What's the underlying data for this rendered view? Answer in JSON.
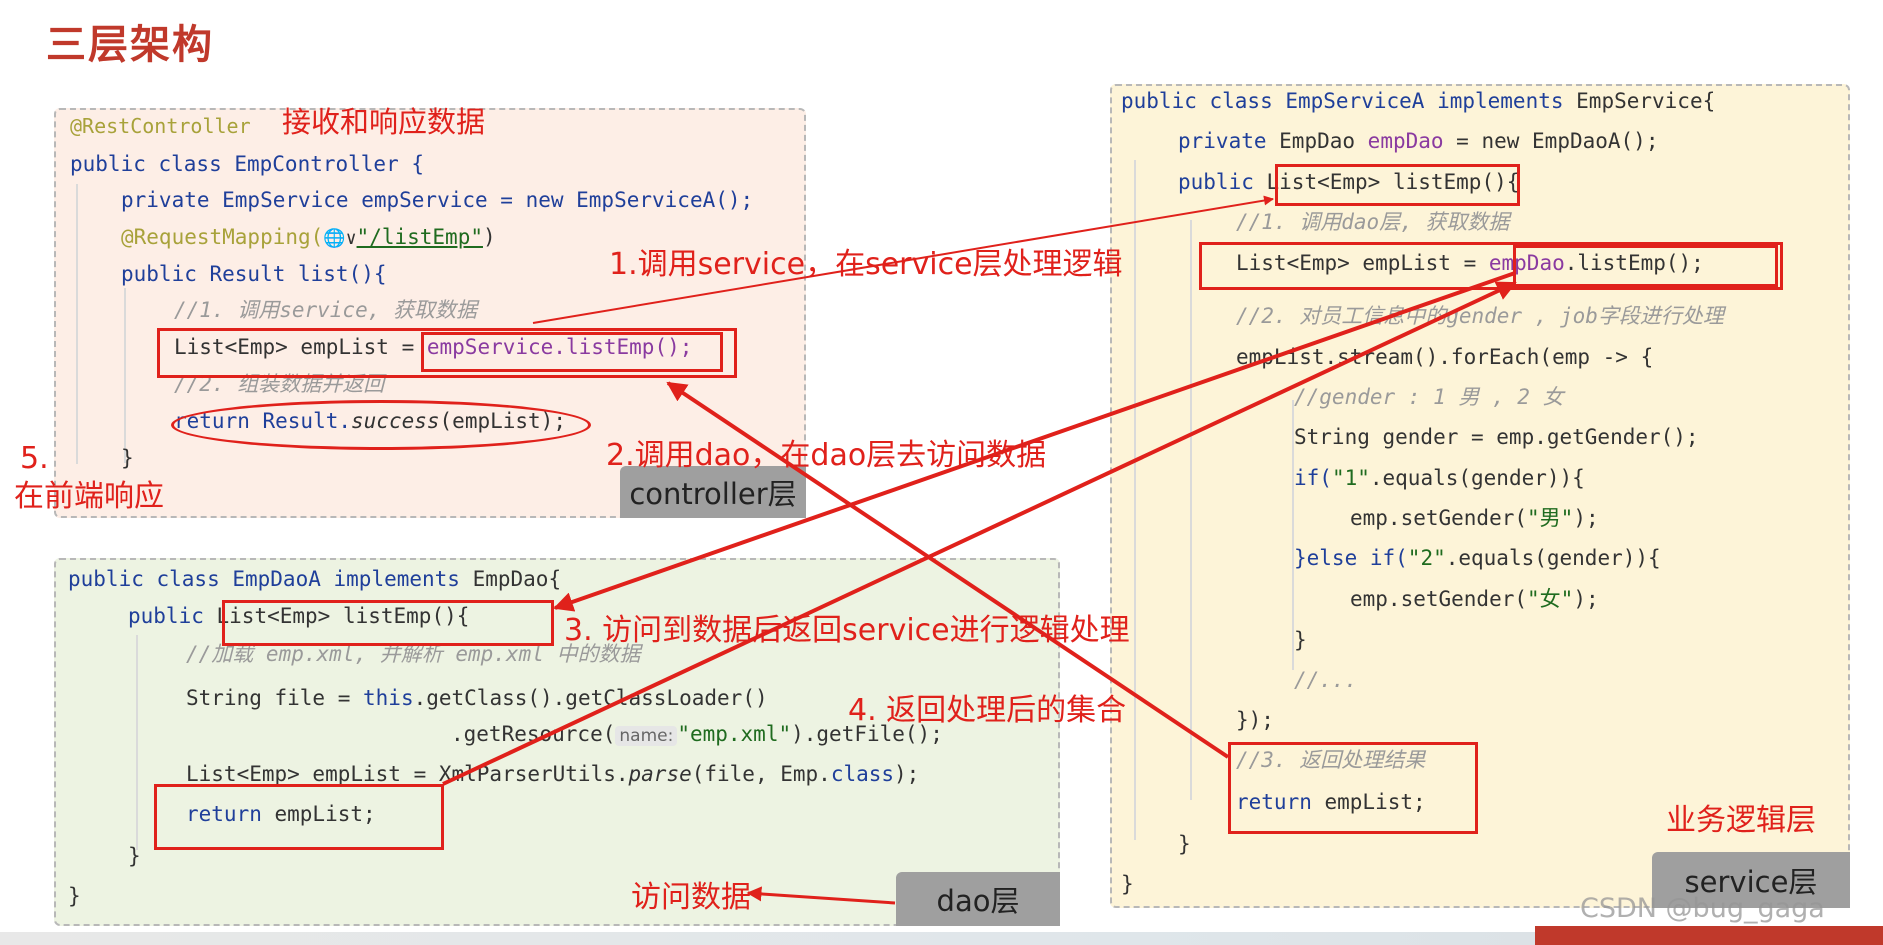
{
  "title": "三层架构",
  "controller_panel": {
    "annotation": "@RestController",
    "label": "接收和响应数据",
    "tag": "controller层",
    "lines": {
      "l1": "public class EmpController {",
      "l2": "private EmpService empService = new EmpServiceA();",
      "l3_ann": "@RequestMapping(",
      "l3_icon": "🌐∨",
      "l3_path": "\"/listEmp\"",
      "l3_end": ")",
      "l4": "public Result list(){",
      "l5": "//1. 调用service, 获取数据",
      "l6_a": "List<Emp> empList = ",
      "l6_b": "empService.listEmp();",
      "l7": "//2. 组装数据并返回",
      "l8_a": "return Result.",
      "l8_b": "success",
      "l8_c": "(empList);",
      "l9": "}"
    }
  },
  "dao_panel": {
    "tag": "dao层",
    "lines": {
      "l1_a": "public class EmpDaoA ",
      "l1_b": "implements",
      "l1_c": " EmpDao{",
      "l2_a": "public ",
      "l2_b": "List<Emp> listEmp(){",
      "l3": "//加载 emp.xml, 并解析 emp.xml 中的数据",
      "l4_a": "String file = ",
      "l4_b": "this",
      "l4_c": ".getClass().getClassLoader()",
      "l5_a": ".getResource(",
      "l5_hint": "name:",
      "l5_str": "\"emp.xml\"",
      "l5_c": ").getFile();",
      "l6_a": "List<Emp> empList = XmlParserUtils.",
      "l6_b": "parse",
      "l6_c": "(file, Emp.",
      "l6_d": "class",
      "l6_e": ");",
      "l7_a": "return",
      "l7_b": " empList;",
      "l8": "}",
      "l9": "}"
    }
  },
  "service_panel": {
    "label": "业务逻辑层",
    "tag": "service层",
    "lines": {
      "l1_a": "public class EmpServiceA ",
      "l1_b": "implements",
      "l1_c": " EmpService{",
      "l2_a": "private ",
      "l2_b": "EmpDao ",
      "l2_c": "empDao",
      "l2_d": " = new EmpDaoA();",
      "l3_a": "public ",
      "l3_b": "List<Emp> listEmp()",
      "l3_c": "{",
      "l4": "//1. 调用dao层, 获取数据",
      "l5_a": "List<Emp> empList = ",
      "l5_b": "empDao",
      "l5_c": ".listEmp();",
      "l6": "//2. 对员工信息中的gender , job字段进行处理",
      "l7": "empList.stream().forEach(emp -> {",
      "l8": "//gender : 1 男 , 2 女",
      "l9": "String gender = emp.getGender();",
      "l10_a": "if(",
      "l10_b": "\"1\"",
      "l10_c": ".equals(gender)){",
      "l11_a": "emp.setGender(",
      "l11_b": "\"男\"",
      "l11_c": ");",
      "l12_a": "}else if(",
      "l12_b": "\"2\"",
      "l12_c": ".equals(gender)){",
      "l13_a": "emp.setGender(",
      "l13_b": "\"女\"",
      "l13_c": ");",
      "l14": "}",
      "l15": "//...",
      "l16": "});",
      "l17": "//3. 返回处理结果",
      "l18_a": "return",
      "l18_b": " empList;",
      "l19": "}",
      "l20": "}"
    }
  },
  "steps": {
    "s1": "1.调用service，在service层处理逻辑",
    "s2": "2.调用dao，在dao层去访问数据",
    "s3": "3. 访问到数据后返回service进行逻辑处理",
    "s4": "4. 返回处理后的集合",
    "s5_num": "5.",
    "s5_text": "在前端响应"
  },
  "access_label": "访问数据",
  "watermark": "CSDN @bug_gaga",
  "colors": {
    "red": "#e0211b",
    "keyword": "#1f3f9a",
    "field": "#8a3aa0"
  }
}
